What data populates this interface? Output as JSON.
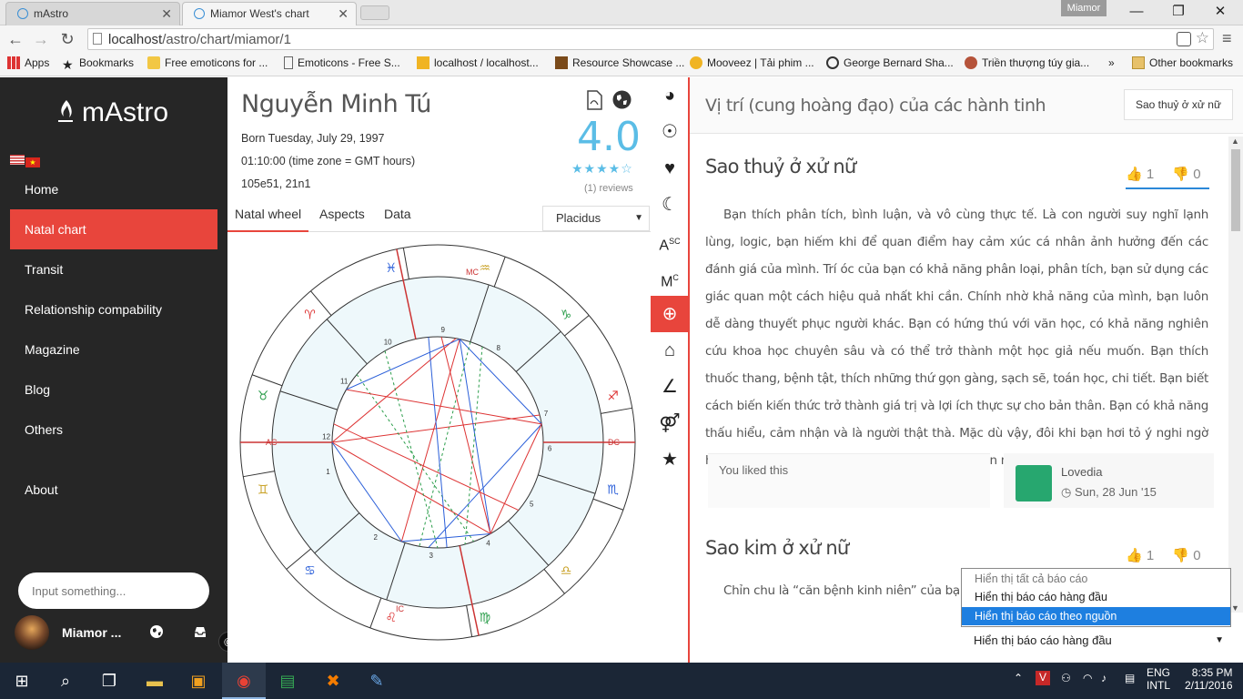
{
  "browser": {
    "tabs": [
      {
        "title": "mAstro"
      },
      {
        "title": "Miamor West's chart"
      }
    ],
    "profile": "Miamor",
    "url_host": "localhost",
    "url_path": "/astro/chart/miamor/1",
    "bookmarks": [
      {
        "label": "Apps"
      },
      {
        "label": "Bookmarks"
      },
      {
        "label": "Free emoticons for ..."
      },
      {
        "label": "Emoticons - Free S..."
      },
      {
        "label": "localhost / localhost..."
      },
      {
        "label": "Resource Showcase ..."
      },
      {
        "label": "Mooveez | Tải phim ..."
      },
      {
        "label": "George Bernard Sha..."
      },
      {
        "label": "Triền thượng túy gia..."
      },
      {
        "label": "»"
      },
      {
        "label": "Other bookmarks"
      }
    ]
  },
  "sidebar": {
    "brand": "mAstro",
    "nav": [
      {
        "label": "Home"
      },
      {
        "label": "Natal chart"
      },
      {
        "label": "Transit"
      },
      {
        "label": "Relationship compability"
      },
      {
        "label": "Magazine"
      },
      {
        "label": "Blog"
      },
      {
        "label": "Others"
      },
      {
        "label": "About"
      }
    ],
    "search_placeholder": "Input something...",
    "user": "Miamor ...",
    "copyright": "©"
  },
  "chart": {
    "name": "Nguyễn Minh Tú",
    "born": "Born Tuesday, July 29, 1997",
    "time": "01:10:00 (time zone = GMT hours)",
    "coords": "105e51, 21n1",
    "score": "4.0",
    "stars": "★★★★☆",
    "reviews": "(1) reviews",
    "tabs": [
      "Natal wheel",
      "Aspects",
      "Data"
    ],
    "house_system": "Placidus",
    "wheel_labels": {
      "ac": "AC",
      "dc": "DC",
      "mc": "MC",
      "ic": "IC",
      "houses": [
        "1",
        "2",
        "3",
        "4",
        "5",
        "6",
        "7",
        "8",
        "9",
        "10",
        "11",
        "12"
      ],
      "signs": [
        "♓",
        "♈",
        "♉",
        "♊",
        "♋",
        "♌",
        "♍",
        "♎",
        "♏",
        "♐",
        "♑",
        "♒"
      ]
    }
  },
  "right": {
    "header_title": "Vị trí (cung hoàng đạo) của các hành tinh",
    "header_button": "Sao thuỷ ở xử nữ",
    "section1": {
      "title": "Sao thuỷ ở xử nữ",
      "likes": "1",
      "dislikes": "0",
      "text": "Bạn thích phân tích, bình luận, và vô cùng thực tế. Là con người suy nghĩ lạnh lùng, logic, bạn hiếm khi để quan điểm hay cảm xúc cá nhân ảnh hưởng đến các đánh giá của mình. Trí óc của bạn có khả năng phân loại, phân tích, bạn sử dụng các giác quan một cách hiệu quả nhất khi cần. Chính nhờ khả năng của mình, bạn luôn dễ dàng thuyết phục người khác. Bạn có hứng thú với văn học, có khả năng nghiên cứu khoa học chuyên sâu và có thể trở thành một học giả nếu muốn. Bạn thích thuốc thang, bệnh tật, thích những thứ gọn gàng, sạch sẽ, toán học, chi tiết. Bạn biết cách biến kiến thức trở thành giá trị và lợi ích thực sự cho bản thân. Bạn có khả năng thấu hiểu, cảm nhận và là người thật thà. Mặc dù vậy, đôi khi bạn hơi tỏ ý nghi ngờ hay coi thường những người kém thông minh hơn mình.",
      "liked_text": "You liked this",
      "author": "Lovedia",
      "date": "Sun, 28 Jun '15"
    },
    "section2": {
      "title": "Sao kim ở xử nữ",
      "likes": "1",
      "dislikes": "0",
      "text": "Chỉn chu là “căn bệnh kinh niên” của bạn, từ về"
    },
    "dropdown": {
      "options": [
        "Hiển thị tất cả báo cáo",
        "Hiển thị báo cáo hàng đầu",
        "Hiển thị báo cáo theo nguồn"
      ],
      "selected": "Hiển thị báo cáo hàng đầu"
    }
  },
  "taskbar": {
    "lang1": "ENG",
    "lang2": "INTL",
    "time": "8:35 PM",
    "date": "2/11/2016"
  }
}
